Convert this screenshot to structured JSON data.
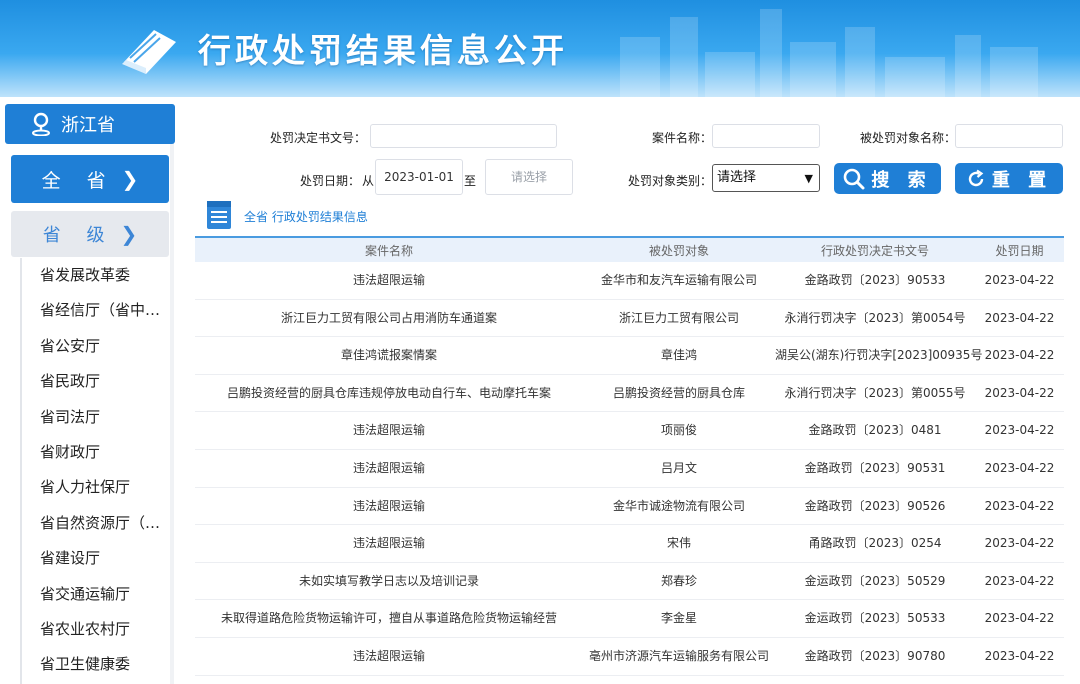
{
  "header": {
    "title": "行政处罚结果信息公开",
    "icon": "book-icon"
  },
  "sidebar": {
    "region": "浙江省",
    "all_label": "全 省",
    "provincial_label": "省 级",
    "items": [
      "省发展改革委",
      "省经信厅（省中…",
      "省公安厅",
      "省民政厅",
      "省司法厅",
      "省财政厅",
      "省人力社保厅",
      "省自然资源厅（…",
      "省建设厅",
      "省交通运输厅",
      "省农业农村厅",
      "省卫生健康委"
    ]
  },
  "filters": {
    "decision_no_label": "处罚决定书文号：",
    "decision_no_value": "",
    "case_name_label": "案件名称：",
    "case_name_value": "",
    "target_name_label": "被处罚对象名称：",
    "target_name_value": "",
    "date_label": "处罚日期：",
    "date_from_label": "从",
    "date_from_value": "2023-01-01",
    "date_to_label": "至",
    "date_to_placeholder": "请选择",
    "target_type_label": "处罚对象类别：",
    "target_type_value": "请选择",
    "search_label": "搜 索",
    "reset_label": "重 置"
  },
  "breadcrumb": "全省 行政处罚结果信息",
  "table": {
    "headers": [
      "案件名称",
      "被处罚对象",
      "行政处罚决定书文号",
      "处罚日期"
    ],
    "rows": [
      [
        "违法超限运输",
        "金华市和友汽车运输有限公司",
        "金路政罚〔2023〕90533",
        "2023-04-22"
      ],
      [
        "浙江巨力工贸有限公司占用消防车通道案",
        "浙江巨力工贸有限公司",
        "永消行罚决字〔2023〕第0054号",
        "2023-04-22"
      ],
      [
        "章佳鸿谎报案情案",
        "章佳鸿",
        "湖吴公(湖东)行罚决字[2023]00935号",
        "2023-04-22"
      ],
      [
        "吕鹏投资经营的厨具仓库违规停放电动自行车、电动摩托车案",
        "吕鹏投资经营的厨具仓库",
        "永消行罚决字〔2023〕第0055号",
        "2023-04-22"
      ],
      [
        "违法超限运输",
        "项丽俊",
        "金路政罚〔2023〕0481",
        "2023-04-22"
      ],
      [
        "违法超限运输",
        "吕月文",
        "金路政罚〔2023〕90531",
        "2023-04-22"
      ],
      [
        "违法超限运输",
        "金华市诚途物流有限公司",
        "金路政罚〔2023〕90526",
        "2023-04-22"
      ],
      [
        "违法超限运输",
        "宋伟",
        "甬路政罚〔2023〕0254",
        "2023-04-22"
      ],
      [
        "未如实填写教学日志以及培训记录",
        "郑春珍",
        "金运政罚〔2023〕50529",
        "2023-04-22"
      ],
      [
        "未取得道路危险货物运输许可，擅自从事道路危险货物运输经营",
        "李金星",
        "金运政罚〔2023〕50533",
        "2023-04-22"
      ],
      [
        "违法超限运输",
        "亳州市济源汽车运输服务有限公司",
        "金路政罚〔2023〕90780",
        "2023-04-22"
      ]
    ]
  },
  "colors": {
    "primary": "#1f7fd6",
    "banner": "#2b9be8",
    "header_bg": "#e9f1fb"
  }
}
